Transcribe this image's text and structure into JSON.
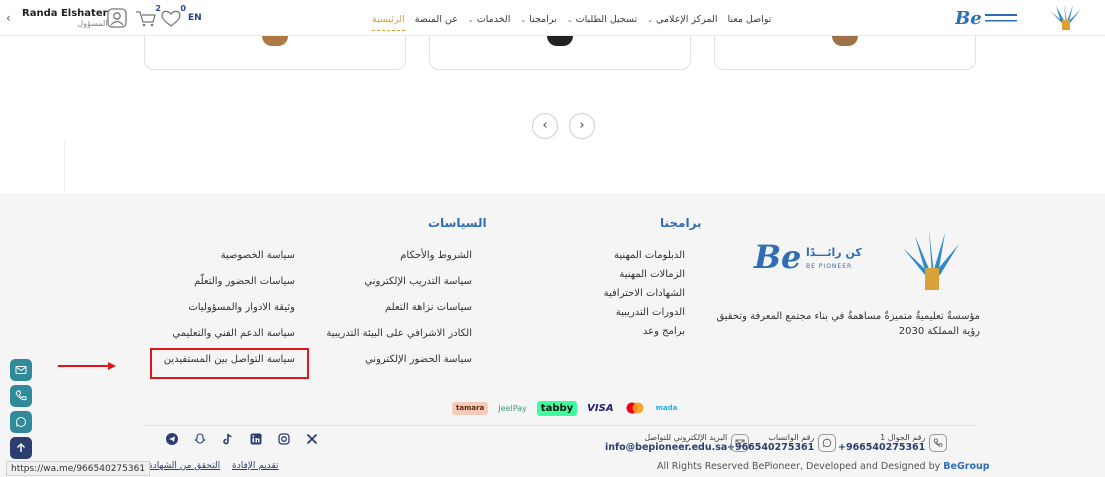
{
  "header": {
    "user_name": "Randa Elshater",
    "user_role": "المسؤول",
    "cart_count": "2",
    "wishlist_count": "0",
    "lang": "EN",
    "nav": [
      {
        "label": "الرئيسية",
        "active": true,
        "has_menu": false
      },
      {
        "label": "عن المنصة",
        "active": false,
        "has_menu": false
      },
      {
        "label": "الخدمات",
        "active": false,
        "has_menu": true
      },
      {
        "label": "برامجنا",
        "active": false,
        "has_menu": true
      },
      {
        "label": "تسجيل الطلبات",
        "active": false,
        "has_menu": true
      },
      {
        "label": "المركز الإعلامي",
        "active": false,
        "has_menu": true
      },
      {
        "label": "تواصل معنا",
        "active": false,
        "has_menu": false
      }
    ]
  },
  "slider": {
    "prev": "‹",
    "next": "›"
  },
  "footer": {
    "programs_title": "برامجنا",
    "programs": [
      "الدبلومات المهنية",
      "الزمالات المهنية",
      "الشهادات الاحترافية",
      "الدورات التدريبية",
      "برامج وعد"
    ],
    "policies_title": "السياسات",
    "policies_col1": [
      "الشروط والأحكام",
      "سياسة التدريب الإلكتروني",
      "سياسات نزاهة التعلم",
      "الكادر الاشرافي على البيئة التدريبية",
      "سياسة الحضور الإلكتروني"
    ],
    "policies_col2": [
      "سياسة الخصوصية",
      "سياسات الحضور والتعلّم",
      "وثيقة الادوار والمسؤوليات",
      "سياسة الدعم الفني والتعليمي",
      "سياسة التواصل بين المستفيدين"
    ],
    "about": "مؤسسةٌ تعليميةٌ متميزةٌ مساهمةٌ في بناء مجتمع المعرفة وتحقيق رؤية المملكة 2030",
    "brand_ar": "كن رائـــدًا",
    "brand_en": "BE PIONEER",
    "payments": [
      "tamara",
      "JeelPay",
      "tabby",
      "VISA",
      "mada"
    ],
    "contacts": [
      {
        "label": "رقم الجوال 1",
        "value": "+966540275361"
      },
      {
        "label": "رقم الواتساب",
        "value": "+966540275361"
      },
      {
        "label": "البريد الإلكتروني للتواصل",
        "value": "info@bepioneer.edu.sa"
      }
    ],
    "copyright_text": "All Rights Reserved BePioneer, Developed and Designed by ",
    "copyright_brand": "BeGroup",
    "bottom_links": [
      "تقديم الإفادة",
      "التحقق من الشهادة"
    ]
  },
  "status_url": "https://wa.me/966540275361",
  "colors": {
    "accent_gold": "#d9a238",
    "brand_blue": "#2f6db5",
    "highlight_red": "#e0161d",
    "float_teal": "#2f8a9a"
  }
}
